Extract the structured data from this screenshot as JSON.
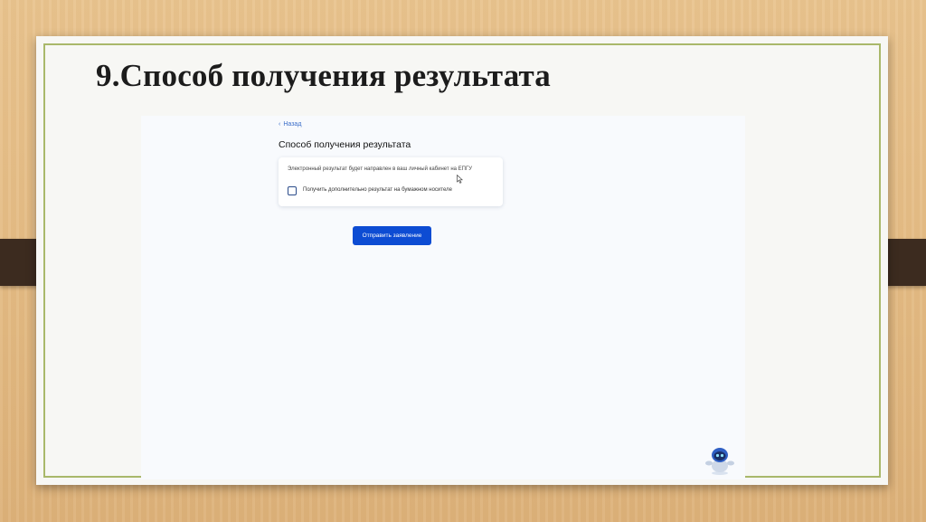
{
  "slide": {
    "title": "9.Способ получения результата"
  },
  "form": {
    "back_label": "Назад",
    "page_title": "Способ получения результата",
    "info_text": "Электронный результат будет направлен в ваш личный кабинет на ЕПГУ",
    "checkbox_label": "Получить дополнительно результат на бумажном носителе",
    "checkbox_checked": false,
    "submit_label": "Отправить заявление"
  },
  "icons": {
    "back": "chevron-left-icon",
    "cursor": "mouse-cursor-icon",
    "assistant": "robot-assistant-icon"
  },
  "colors": {
    "accent": "#0d4cd3",
    "link": "#3b6ec9",
    "slide_border": "#a9b86a",
    "strap": "#3c2b1f"
  }
}
